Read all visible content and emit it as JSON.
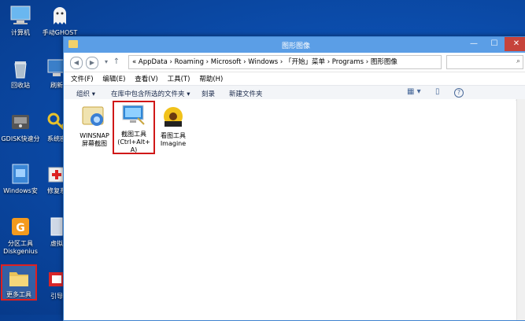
{
  "desktop_icons": [
    {
      "label": "计算机"
    },
    {
      "label": "手动GHOST"
    },
    {
      "label": "回收站"
    },
    {
      "label": "刷新"
    },
    {
      "label": "GDISK快速分"
    },
    {
      "label": "系统密"
    },
    {
      "label": "Windows安"
    },
    {
      "label": "修复系"
    },
    {
      "label": "分区工具"
    },
    {
      "label": "Diskgenius"
    },
    {
      "label": "虚拟"
    },
    {
      "label": "更多工具"
    },
    {
      "label": "引导"
    }
  ],
  "window": {
    "title": "图形图像",
    "address": "« AppData › Roaming › Microsoft › Windows › 「开始」菜单 › Programs › 图形图像",
    "min": "—",
    "max": "☐",
    "close": "✕"
  },
  "menu": [
    "文件(F)",
    "编辑(E)",
    "查看(V)",
    "工具(T)",
    "帮助(H)"
  ],
  "toolbar": {
    "organize": "组织 ▾",
    "include": "在库中包含所选的文件夹 ▾",
    "burn": "刻录",
    "new_folder": "新建文件夹",
    "help": "?"
  },
  "files": [
    {
      "line1": "WINSNAP",
      "line2": "屏幕截图",
      "line3": ""
    },
    {
      "line1": "截图工具",
      "line2": "(Ctrl+Alt+",
      "line3": "A)"
    },
    {
      "line1": "看图工具",
      "line2": "Imagine",
      "line3": ""
    }
  ],
  "colors": {
    "accent": "#5b9ee6",
    "selection": "#d01818",
    "desktop": "#0c4fb0"
  }
}
